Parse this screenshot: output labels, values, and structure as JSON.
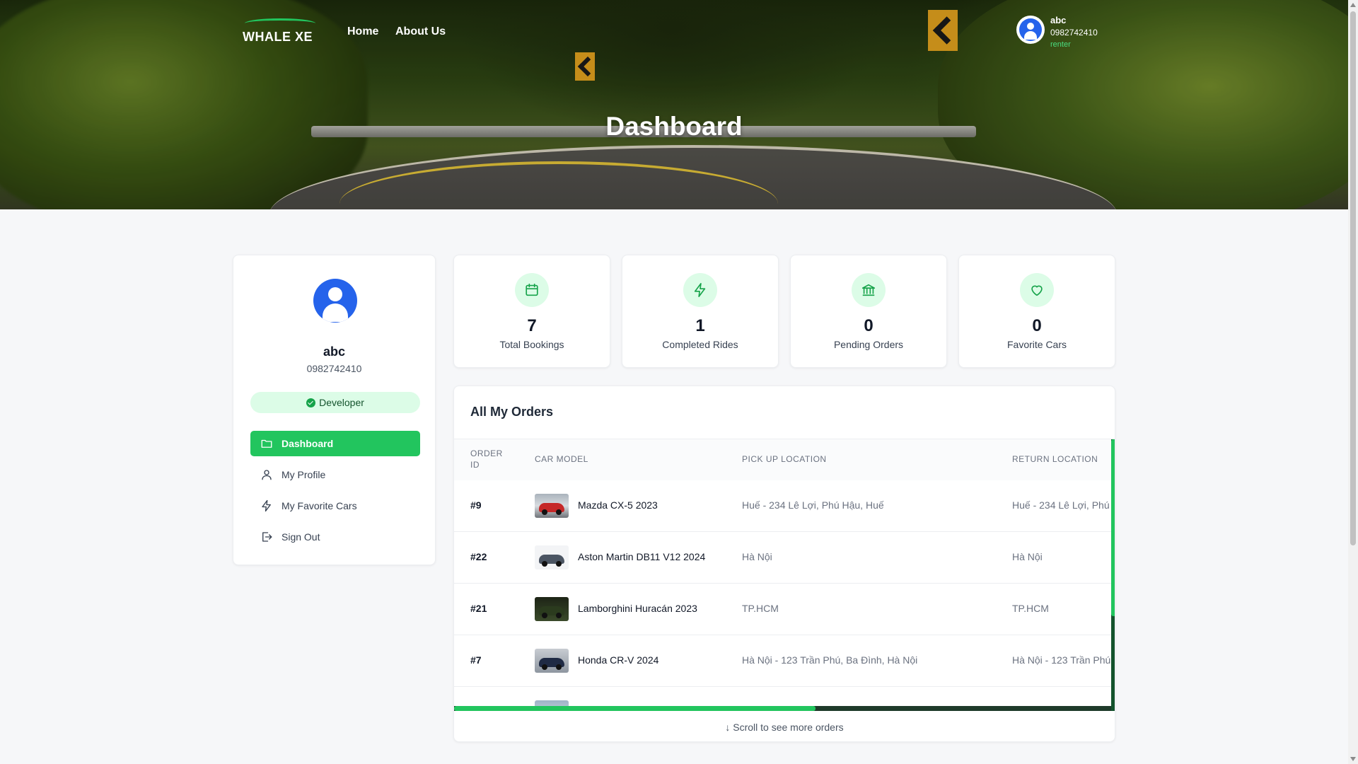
{
  "nav": {
    "logo_text": "WHALE XE",
    "links": [
      "Home",
      "About Us"
    ]
  },
  "user": {
    "name": "abc",
    "phone": "0982742410",
    "role": "renter"
  },
  "hero": {
    "title": "Dashboard"
  },
  "profile": {
    "name": "abc",
    "phone": "0982742410",
    "badge": "Developer",
    "menu": [
      {
        "label": "Dashboard",
        "icon": "folder-icon",
        "active": true
      },
      {
        "label": "My Profile",
        "icon": "user-icon",
        "active": false
      },
      {
        "label": "My Favorite Cars",
        "icon": "bolt-icon",
        "active": false
      },
      {
        "label": "Sign Out",
        "icon": "sign-out-icon",
        "active": false
      }
    ]
  },
  "stats": [
    {
      "value": "7",
      "label": "Total Bookings",
      "icon": "calendar-icon"
    },
    {
      "value": "1",
      "label": "Completed Rides",
      "icon": "bolt-icon"
    },
    {
      "value": "0",
      "label": "Pending Orders",
      "icon": "bank-icon"
    },
    {
      "value": "0",
      "label": "Favorite Cars",
      "icon": "heart-icon"
    }
  ],
  "orders": {
    "title": "All My Orders",
    "columns": [
      "ORDER ID",
      "CAR MODEL",
      "PICK UP LOCATION",
      "RETURN LOCATION"
    ],
    "rows": [
      {
        "id": "#9",
        "model": "Mazda CX-5 2023",
        "pickup": "Huế - 234 Lê Lợi, Phú Hậu, Huế",
        "return": "Huế - 234 Lê Lợi, Phú",
        "car_color": "#c62828"
      },
      {
        "id": "#22",
        "model": "Aston Martin DB11 V12 2024",
        "pickup": "Hà Nội",
        "return": "Hà Nội",
        "car_color": "#4b5563"
      },
      {
        "id": "#21",
        "model": "Lamborghini Huracán 2023",
        "pickup": "TP.HCM",
        "return": "TP.HCM",
        "car_color": "#1f2d18"
      },
      {
        "id": "#7",
        "model": "Honda CR-V 2024",
        "pickup": "Hà Nội - 123 Trần Phú, Ba Đình, Hà Nội",
        "return": "Hà Nội - 123 Trần Phú",
        "car_color": "#1f2a44"
      }
    ],
    "scroll_hint": "Scroll to see more orders"
  },
  "colors": {
    "accent": "#22c55e",
    "accent_soft": "#dcfce7",
    "avatar_blue": "#2563eb"
  }
}
